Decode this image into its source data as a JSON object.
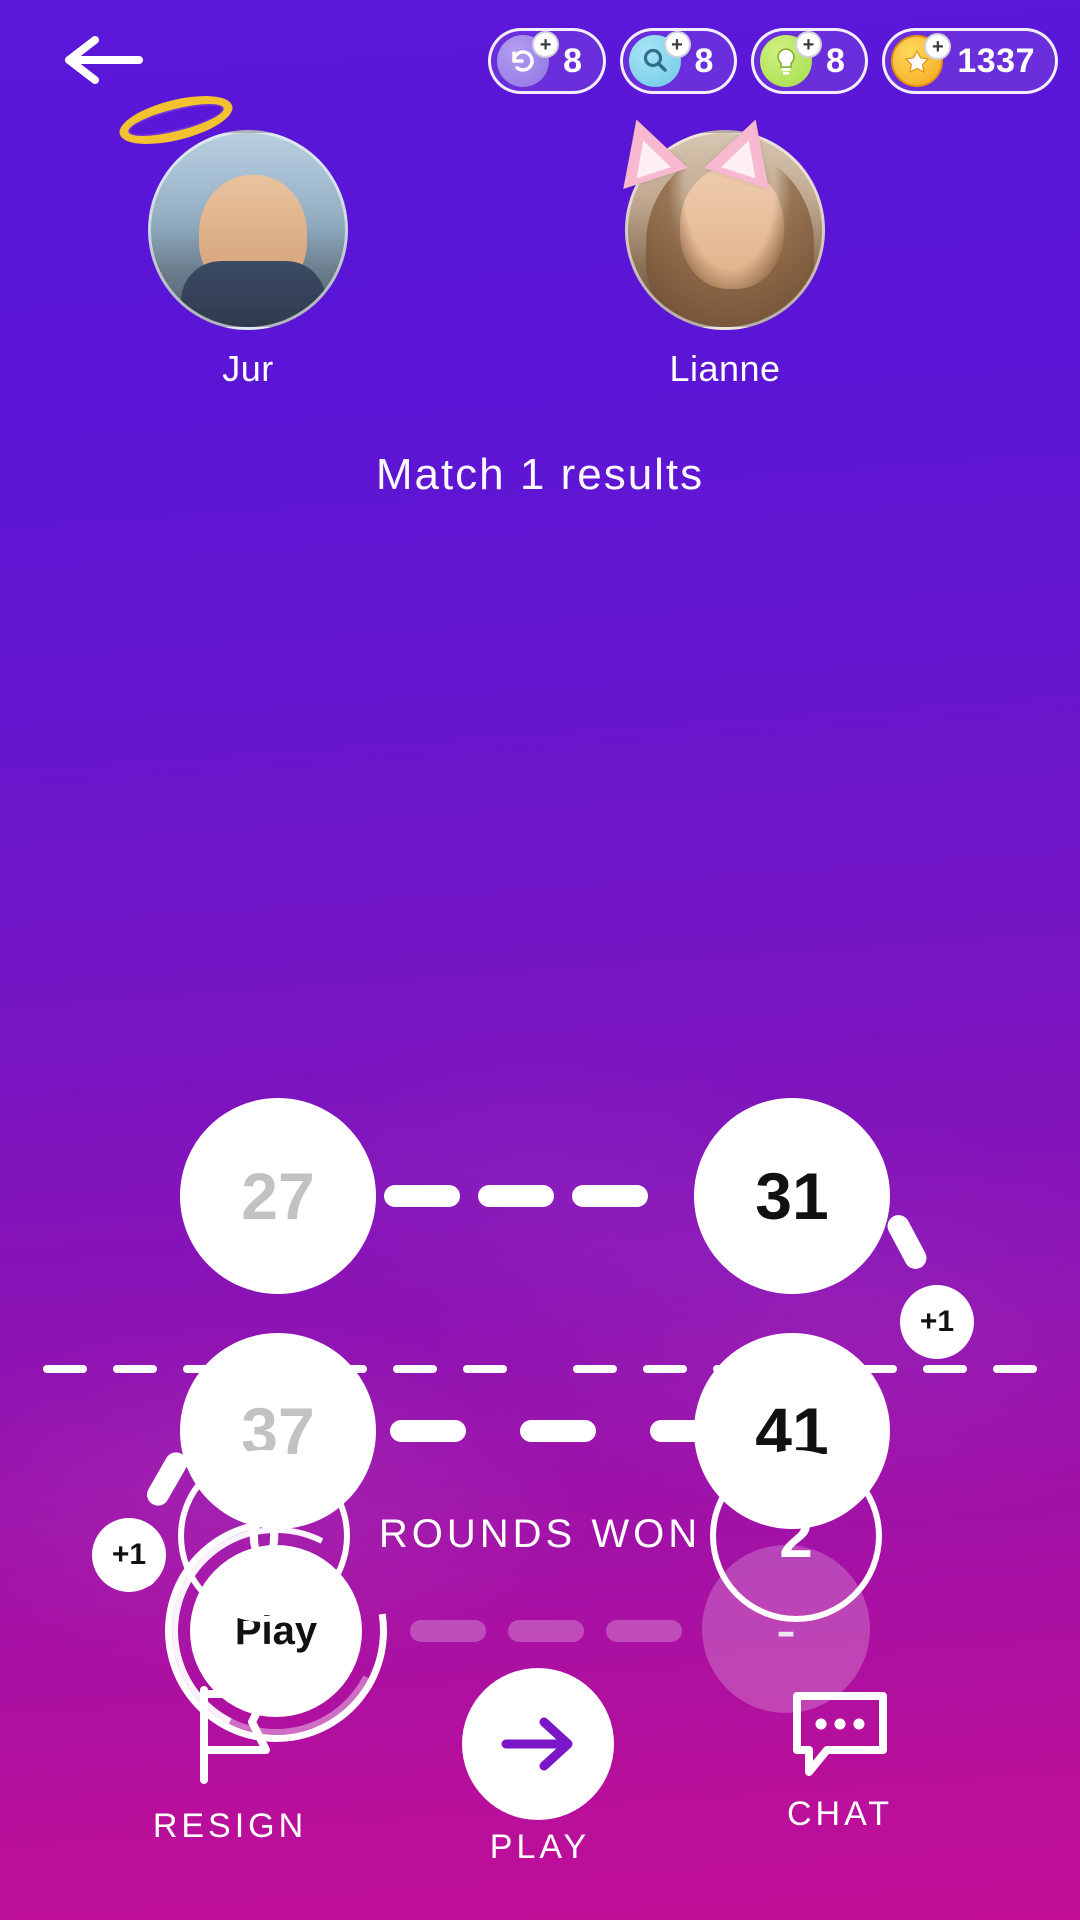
{
  "topbar": {
    "back_icon": "arrow-left-icon",
    "pills": [
      {
        "icon": "undo-icon",
        "plus": "+",
        "count": "8"
      },
      {
        "icon": "magnifier-icon",
        "plus": "+",
        "count": "8"
      },
      {
        "icon": "lightbulb-icon",
        "plus": "+",
        "count": "8"
      },
      {
        "icon": "coin-star-icon",
        "plus": "+",
        "count": "1337"
      }
    ]
  },
  "players": {
    "left": {
      "name": "Jur",
      "decoration": "halo-icon"
    },
    "right": {
      "name": "Lianne",
      "decoration": "cat-ears-icon"
    }
  },
  "match": {
    "title": "Match 1 results",
    "nodes": [
      {
        "id": "r1-left",
        "value": "27",
        "state": "dim"
      },
      {
        "id": "r1-right",
        "value": "31",
        "state": "solid"
      },
      {
        "id": "r1-bonus",
        "value": "+1",
        "state": "bonus"
      },
      {
        "id": "r2-left",
        "value": "37",
        "state": "dim"
      },
      {
        "id": "r2-right",
        "value": "41",
        "state": "solid"
      },
      {
        "id": "r2-bonus",
        "value": "+1",
        "state": "bonus"
      },
      {
        "id": "r3-left",
        "value": "Play",
        "state": "active"
      },
      {
        "id": "r3-right",
        "value": "-",
        "state": "pending"
      }
    ]
  },
  "rounds": {
    "label": "ROUNDS WON",
    "left_score": "0",
    "right_score": "2"
  },
  "bottom_nav": {
    "resign": {
      "label": "RESIGN",
      "icon": "flag-icon"
    },
    "play": {
      "label": "PLAY",
      "icon": "arrow-right-icon"
    },
    "chat": {
      "label": "CHAT",
      "icon": "chat-bubble-icon"
    }
  },
  "colors": {
    "bg_top": "#5b18d8",
    "bg_bottom": "#c20e96",
    "white": "#ffffff",
    "dim_text": "#c2c2c2",
    "coin_gold": "#f3a71d"
  }
}
